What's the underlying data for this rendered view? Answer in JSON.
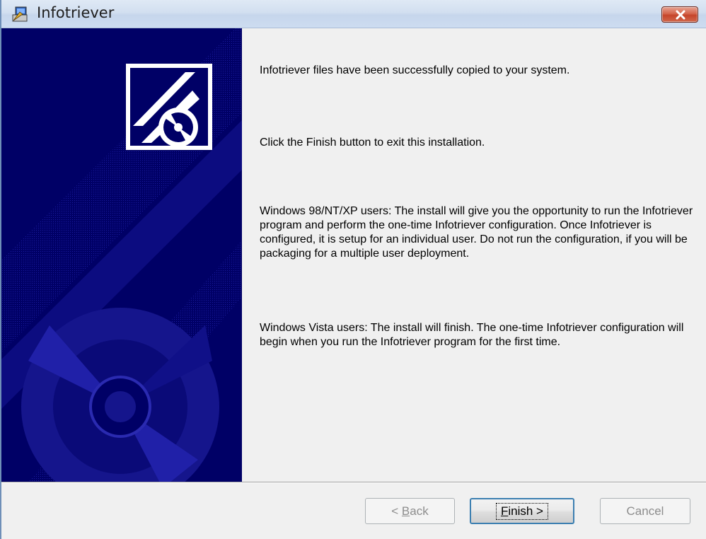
{
  "window": {
    "title": "Infotriever",
    "app_icon": "installer-computer-icon",
    "close_icon": "close-icon"
  },
  "content": {
    "line1": "Infotriever files have been successfully copied to your system.",
    "line2": "Click the Finish button to exit this installation.",
    "para_xp": "Windows 98/NT/XP users: The install will give you the opportunity to  run the Infotriever program and perform the one-time Infotriever configuration. Once Infotriever is configured, it is setup for an individual user. Do not run the configuration, if you will be packaging for a multiple user deployment.",
    "para_vista": "Windows Vista users: The install will finish. The one-time Infotriever configuration will begin when you run the Infotriever program for the first time."
  },
  "buttons": {
    "back": {
      "prefix": "< ",
      "mnemonic": "B",
      "rest": "ack",
      "enabled": false
    },
    "finish": {
      "mnemonic": "F",
      "rest": "inish >",
      "enabled": true
    },
    "cancel": {
      "label": "Cancel",
      "enabled": false
    }
  },
  "colors": {
    "banner_bg": "#000066",
    "banner_accent": "#1a1a9a",
    "titlebar": "#d2dff0",
    "close_button": "#c5452b"
  }
}
